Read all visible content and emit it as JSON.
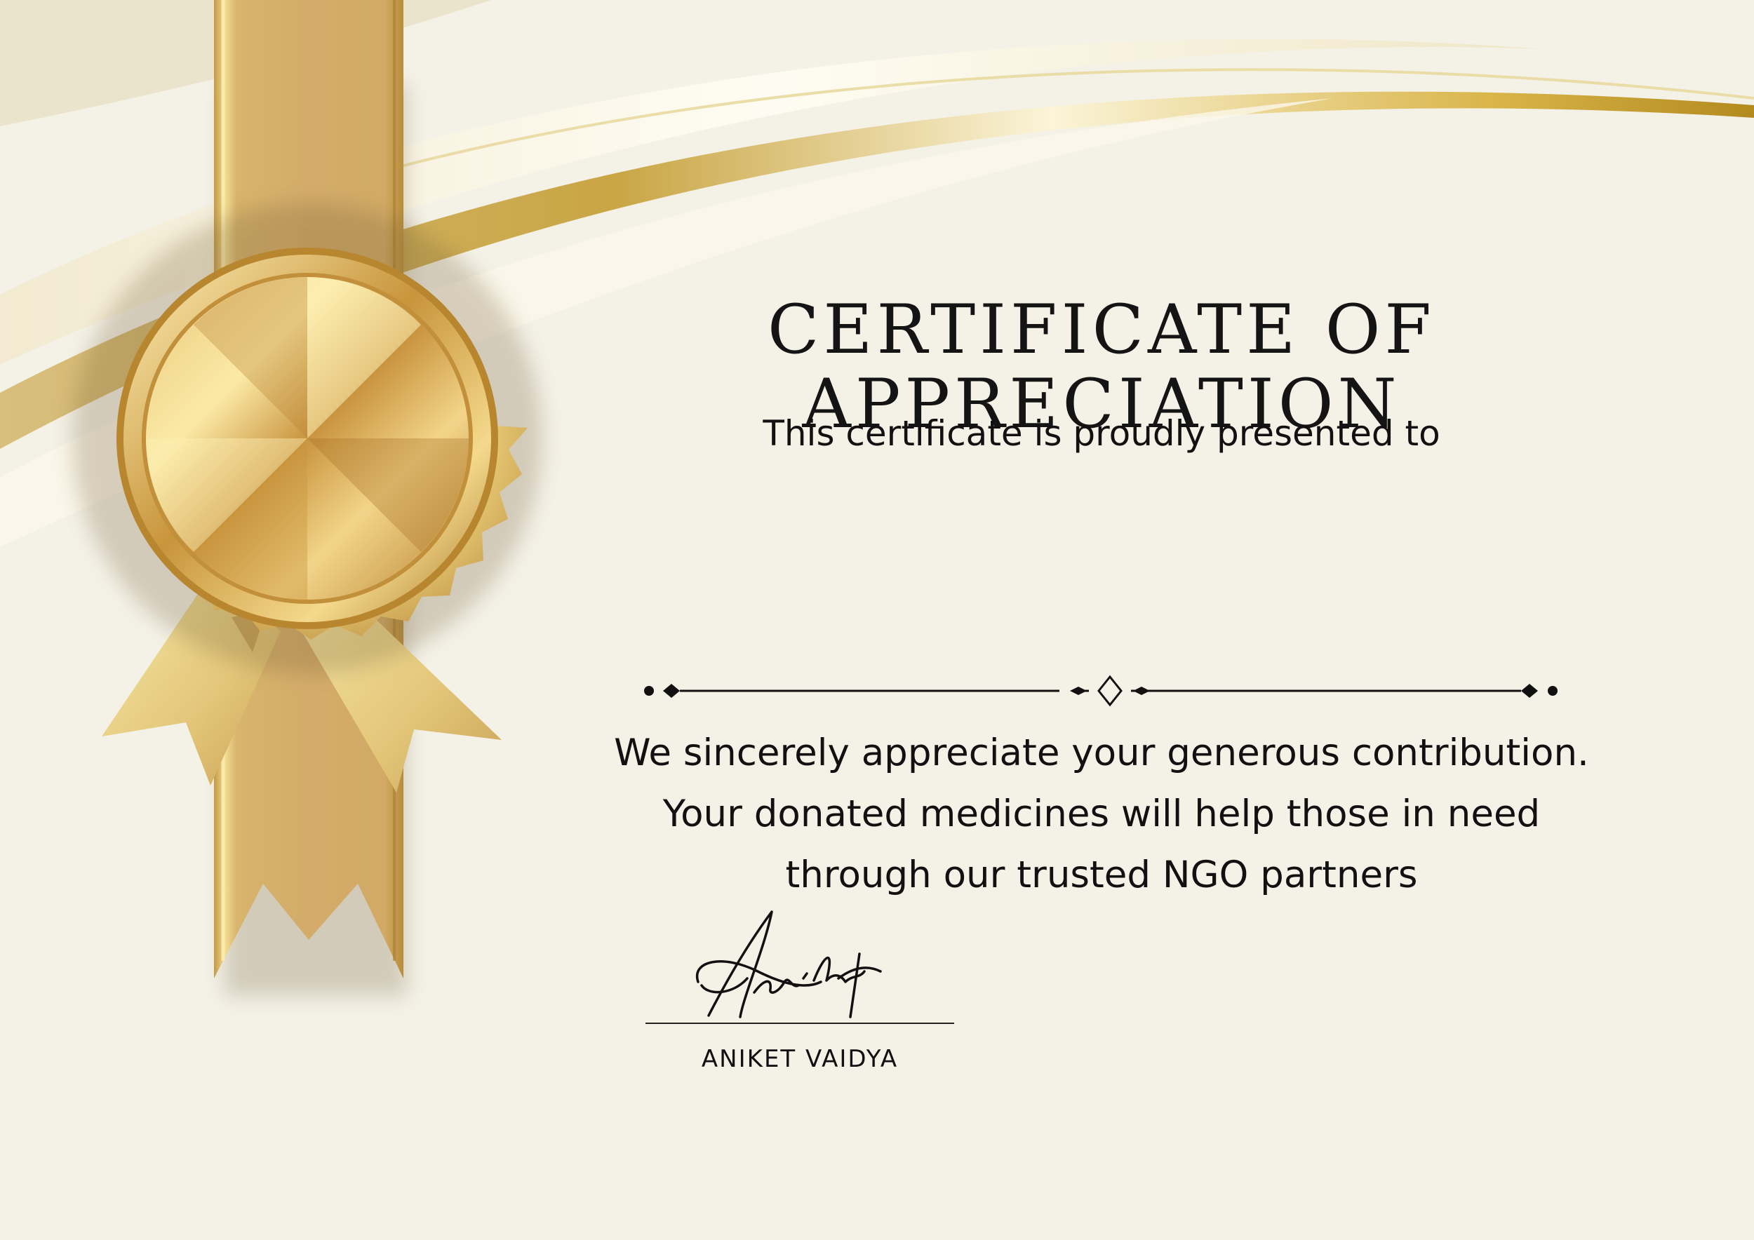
{
  "certificate": {
    "title": "CERTIFICATE OF APPRECIATION",
    "subtitle": "This certificate is proudly presented to",
    "recipient_name": "",
    "message_lines": [
      "We sincerely appreciate your generous contribution.",
      "Your donated medicines will help those in need",
      "through our trusted NGO partners"
    ],
    "signature_script": "Aniket",
    "signatory_name": "ANIKET VAIDYA"
  },
  "decorations": {
    "seal": "gold-rosette-seal",
    "ribbon": "gold-vertical-ribbon",
    "divider": "ornamental-diamond-divider"
  },
  "colors": {
    "background": "#f4f1e6",
    "gold_light": "#f6e4a4",
    "gold_mid": "#d8b566",
    "gold_dark": "#b8922f",
    "text": "#111111"
  }
}
